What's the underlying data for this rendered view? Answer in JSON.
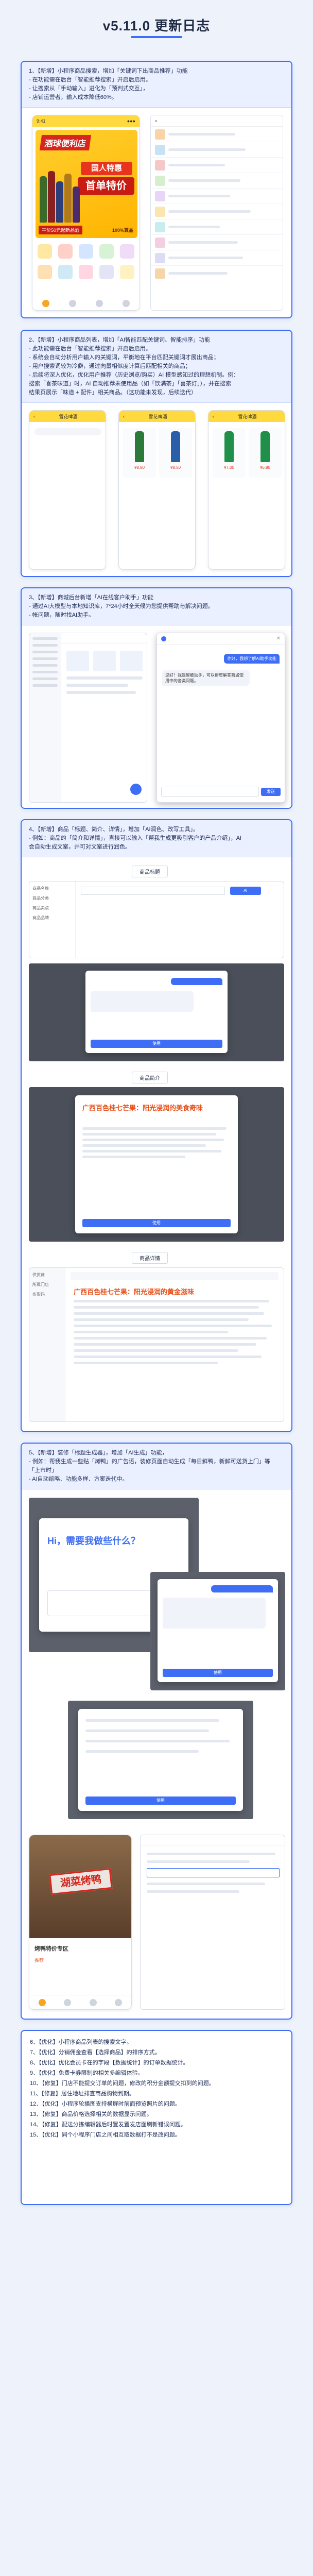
{
  "page": {
    "title": "v5.11.0 更新日志"
  },
  "section1": {
    "lines": [
      "1、【新增】小程序商品搜索，增加「关键词下出商品推荐」功能",
      "- 在功能需在后台「智能推荐搜索」开启后启用。",
      "- 让搜索从「手动输入」进化为「预判式交互」，",
      "- 店铺运营者，输入成本降低60%。"
    ],
    "poster": {
      "brand": "酒球便利店",
      "promo_top": "国人特惠",
      "promo_main": "首单特价",
      "ribbon": "平价50元起新品酒",
      "percent": "100%真品"
    }
  },
  "section2": {
    "lines": [
      "2、【新增】小程序商品列表，增加「AI智能匹配关键词、智能排序」功能",
      "- 此功能需在后台「智能推荐搜索」开启后启用。",
      "- 系统会自动分析用户输入的关键词，平衡地在平台匹配关键词才展出商品；",
      "- 用户搜索词较为冷僻，通过向量相似度计算后匹配相关的商品；",
      "- 后续将深入优化，优化用户推荐（历史浏览/购买）AI 模型感知过的理想机制。例：",
      "搜索「喜茶味道」时，AI 自动推荐未使用品（如「饮满茶」「喜茶灯」），并在搜索",
      "结果页展示「味道 + 配件」相关商品。（这功能未发现，后续迭代）"
    ],
    "product_prices": [
      "¥8.80",
      "¥8.50",
      "¥7.00",
      "¥6.80"
    ],
    "header_label": "雪花啤酒"
  },
  "section3": {
    "lines": [
      "3、【新增】商城后台新增「AI在线客户助手」功能",
      "- 通过AI大模型与本地知识库，7*24小时全天候为您提供帮助与解决问题。",
      "- 帐问题，随时找AI助手。"
    ],
    "chat": {
      "user_msg": "你好，我想了解AI助手功能",
      "ai_msg": "您好！我是智能助手，可以帮您解答商城使用中的各类问题。",
      "send_label": "发送"
    }
  },
  "section4": {
    "lines": [
      "4、【新增】商品「标题、简介、详情」，增加「AI润色、改写工具」。",
      "- 例如：商品的「简介和详情」，直接可以输入「帮我生成更吸引客户的产品介绍」，AI",
      "会自动生成文案，并可对文案进行润色。"
    ],
    "label_title": "商品标题",
    "label_intro": "商品简介",
    "label_detail": "商品详情",
    "ai_article_title": "广西百色桂七芒果：阳光浸润的美食奇味",
    "ai_article_title2": "广西百色桂七芒果：阳光浸润的黄金滋味",
    "use_label": "使用",
    "form_fields": [
      "商品名称",
      "商品分类",
      "商品卖点",
      "商品品牌",
      "供货商",
      "所属门店",
      "条形码"
    ]
  },
  "section5": {
    "lines": [
      "5、【新增】装修「标题生成器」，增加「AI生成」功能，",
      "- 例如：帮我生成一些贴「烤鸭」的广告语，装修页面自动生成「每日鲜鸭，新鲜可送货上门」等",
      "  「上市时」",
      "- AI自动缩略、功能多样、方案迭代中。"
    ],
    "greeting": "Hi，需要我做些什么？",
    "promo_stamp": "湖菜烤鸭",
    "promo_sub": "烤鸭特价专区",
    "recommend": "推荐"
  },
  "section6": {
    "lines": [
      "6、【优化】小程序商品列表的搜索文字。",
      "7、【优化】分销佣金查看【选择商品】的排序方式。",
      "8、【优化】优化会员卡在的字段【数据统计】的订单数据统计。",
      "9、【优化】免费卡券限制的相关多编辑体验。",
      "10、【修复】门店不能提交订单的问题，修改的积分金额提交扣到的问题。",
      "11、【修复】居住地址排查商品购物到期。",
      "12、【优化】小程序轮播图支持横屏时前面预览照片的问题。",
      "13、【修复】商品价格选择相关的数据显示问题。",
      "14、【修复】配送分拣编辑器后时置发置发店面刷新错误问题。",
      "15、【优化】同个小程序门店之间相互取数据打不是改问题。"
    ]
  },
  "colors": {
    "accent": "#3d6ef5",
    "poster_yellow": "#ffcf2e",
    "promo_red": "#e8341c",
    "orange_text": "#e8511c"
  }
}
